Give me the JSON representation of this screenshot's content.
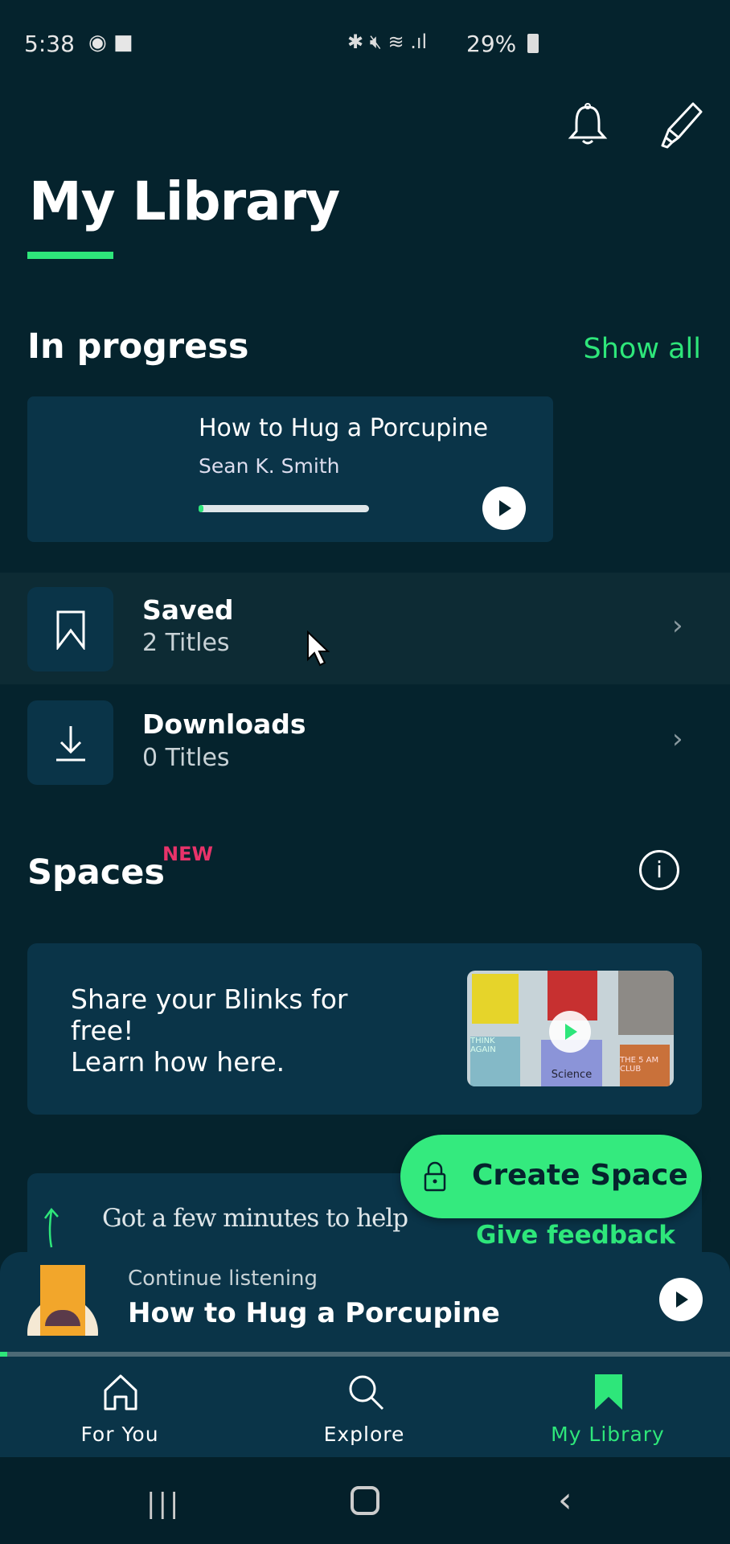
{
  "status_bar": {
    "time": "5:38",
    "battery": "29%"
  },
  "header": {
    "title": "My Library"
  },
  "in_progress": {
    "heading": "In progress",
    "show_all": "Show all",
    "book": {
      "title": "How to Hug a Porcupine",
      "author": "Sean K. Smith",
      "progress_fraction": 0.03
    }
  },
  "lists": [
    {
      "label": "Saved",
      "count": "2 Titles",
      "icon": "bookmark-icon"
    },
    {
      "label": "Downloads",
      "count": "0 Titles",
      "icon": "download-icon"
    }
  ],
  "spaces": {
    "heading": "Spaces",
    "badge": "NEW",
    "promo_lines": [
      "Share your Blinks for",
      "free!",
      "Learn how here."
    ],
    "thumb_labels": [
      "Science",
      "THINK AGAIN",
      "THE 5 AM CLUB"
    ],
    "feedback_text": "Got a few minutes to help",
    "create_label": "Create Space",
    "feedback_label": "Give feedback"
  },
  "player": {
    "caption": "Continue listening",
    "title": "How to Hug a Porcupine",
    "progress_fraction": 0.01
  },
  "nav": {
    "items": [
      {
        "label": "For You"
      },
      {
        "label": "Explore"
      },
      {
        "label": "My Library"
      }
    ],
    "active": "My Library"
  },
  "colors": {
    "accent": "#2ee67a",
    "background": "#05232d",
    "card": "#0a3448",
    "badge": "#e8336a"
  }
}
